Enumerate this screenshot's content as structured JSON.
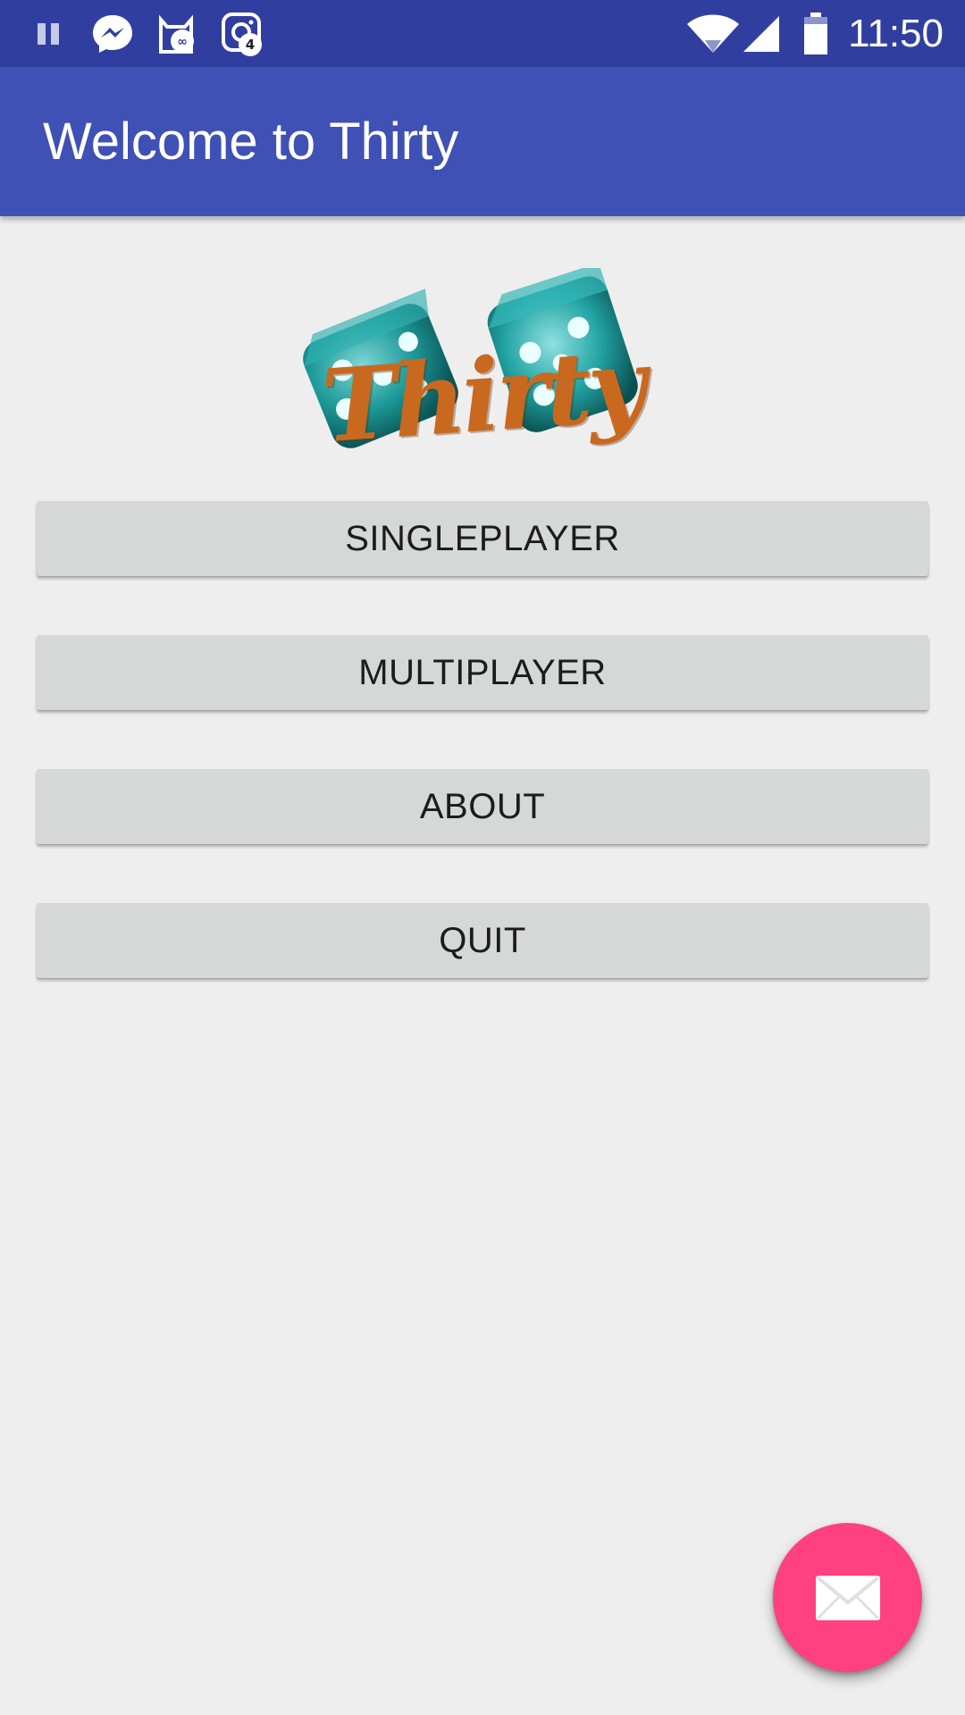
{
  "status_bar": {
    "time": "11:50",
    "background_color": "#303f9f",
    "left_icons": [
      "pause-icon",
      "messenger-icon",
      "cat-app-icon",
      "instagram-icon"
    ],
    "instagram_badge": "4",
    "cat_app_badge": "∞",
    "right_icons": [
      "wifi-icon",
      "cell-signal-icon",
      "battery-icon"
    ]
  },
  "app_bar": {
    "title": "Welcome to Thirty",
    "background_color": "#3f51b5"
  },
  "logo": {
    "word": "Thirty",
    "icon": "dice-logo",
    "dice_color": "#1e9a9a",
    "text_color": "#c8691f"
  },
  "menu": {
    "singleplayer": "SINGLEPLAYER",
    "multiplayer": "MULTIPLAYER",
    "about": "ABOUT",
    "quit": "QUIT"
  },
  "fab": {
    "icon": "mail-icon",
    "color": "#ff4081"
  }
}
